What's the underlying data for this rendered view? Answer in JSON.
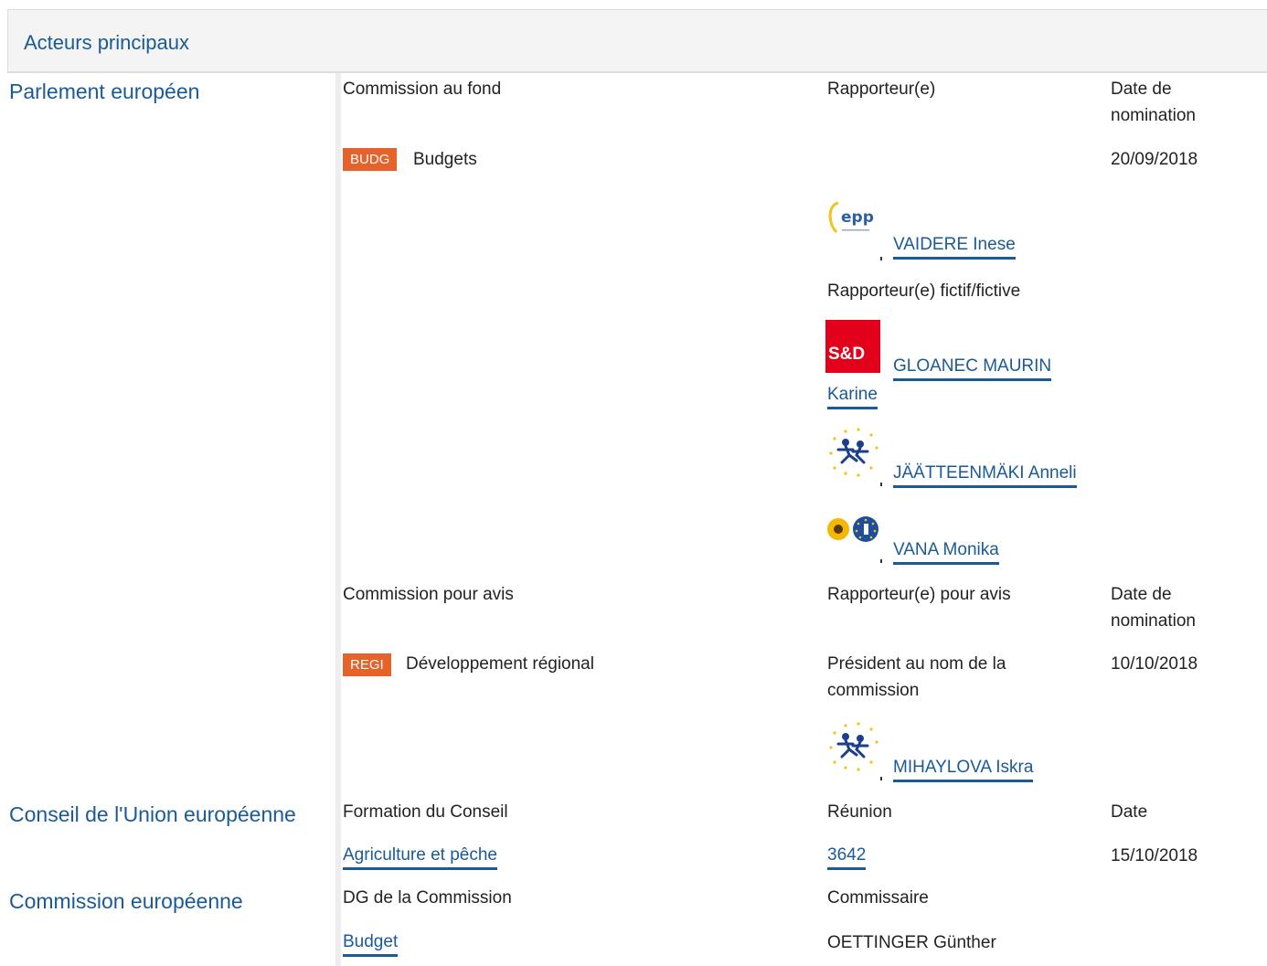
{
  "header": {
    "title": "Acteurs principaux"
  },
  "parlement": {
    "section_label": "Parlement européen",
    "fond": {
      "col_commission": "Commission au fond",
      "col_rapporteur": "Rapporteur(e)",
      "col_date": "Date de\nnomination",
      "committee_tag": "BUDG",
      "committee_name": "Budgets",
      "date": "20/09/2018",
      "rapporteur": {
        "group_logo": "epp-logo",
        "name": "VAIDERE Inese"
      },
      "shadow_label": "Rapporteur(e) fictif/fictive",
      "shadows": [
        {
          "group_logo": "s-and-d-logo",
          "logo_text": "S&D",
          "name_line1": "GLOANEC MAURIN",
          "name_line2": "Karine"
        },
        {
          "group_logo": "alde-logo",
          "name": "JÄÄTTEENMÄKI Anneli"
        },
        {
          "group_logo": "greens-efa-logo",
          "name": "VANA Monika"
        }
      ]
    },
    "avis": {
      "col_commission": "Commission pour avis",
      "col_rapporteur": "Rapporteur(e) pour avis",
      "col_date": "Date de\nnomination",
      "committee_tag": "REGI",
      "committee_name": "Développement régional",
      "role": "Président au nom de la\ncommission",
      "date": "10/10/2018",
      "rapporteur": {
        "group_logo": "alde-logo",
        "name": "MIHAYLOVA Iskra"
      }
    }
  },
  "conseil": {
    "section_label": "Conseil de l'Union européenne",
    "col_formation": "Formation du Conseil",
    "col_reunion": "Réunion",
    "col_date": "Date",
    "formation": "Agriculture et pêche",
    "reunion": "3642",
    "date": "15/10/2018"
  },
  "commission": {
    "section_label": "Commission européenne",
    "col_dg": "DG de la Commission",
    "col_commissaire": "Commissaire",
    "dg": "Budget",
    "commissaire": "OETTINGER Günther"
  },
  "colors": {
    "link": "#1a5a96",
    "tag": "#e5622a",
    "header_bg": "#f4f4f4"
  }
}
